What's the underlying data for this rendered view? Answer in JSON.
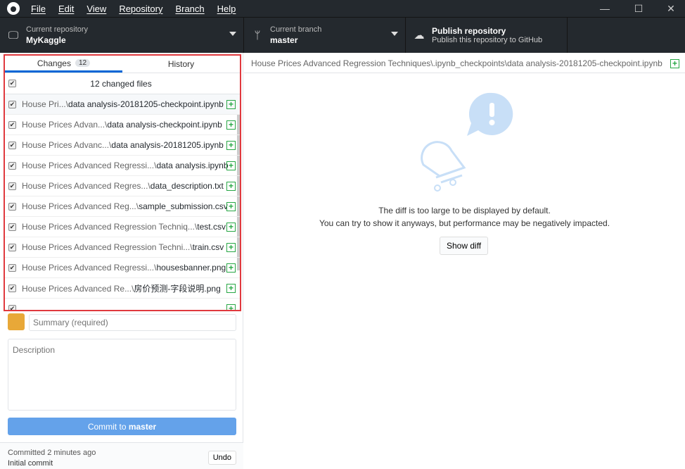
{
  "menu": [
    "File",
    "Edit",
    "View",
    "Repository",
    "Branch",
    "Help"
  ],
  "toolbar": {
    "repo_label": "Current repository",
    "repo_name": "MyKaggle",
    "branch_label": "Current branch",
    "branch_name": "master",
    "publish_title": "Publish repository",
    "publish_sub": "Publish this repository to GitHub"
  },
  "tabs": {
    "changes": "Changes",
    "changes_count": "12",
    "history": "History"
  },
  "changed_header": "12 changed files",
  "files": [
    {
      "dir": "House Pri...\\",
      "name": "data analysis-20181205-checkpoint.ipynb"
    },
    {
      "dir": "House Prices Advan...\\",
      "name": "data analysis-checkpoint.ipynb"
    },
    {
      "dir": "House Prices Advanc...\\",
      "name": "data analysis-20181205.ipynb"
    },
    {
      "dir": "House Prices Advanced Regressi...\\",
      "name": "data analysis.ipynb"
    },
    {
      "dir": "House Prices Advanced Regres...\\",
      "name": "data_description.txt"
    },
    {
      "dir": "House Prices Advanced Reg...\\",
      "name": "sample_submission.csv"
    },
    {
      "dir": "House Prices Advanced Regression Techniq...\\",
      "name": "test.csv"
    },
    {
      "dir": "House Prices Advanced Regression Techni...\\",
      "name": "train.csv"
    },
    {
      "dir": "House Prices Advanced Regressi...\\",
      "name": "housesbanner.png"
    },
    {
      "dir": "House Prices Advanced Re...\\",
      "name": "房价预测-字段说明.png"
    }
  ],
  "commit": {
    "summary_placeholder": "Summary (required)",
    "description_placeholder": "Description",
    "button_prefix": "Commit to ",
    "button_branch": "master"
  },
  "last_commit": {
    "time": "Committed 2 minutes ago",
    "message": "Initial commit",
    "undo": "Undo"
  },
  "diff": {
    "path": "House Prices Advanced Regression Techniques\\.ipynb_checkpoints\\data analysis-20181205-checkpoint.ipynb",
    "line1": "The diff is too large to be displayed by default.",
    "line2": "You can try to show it anyways, but performance may be negatively impacted.",
    "button": "Show diff"
  }
}
